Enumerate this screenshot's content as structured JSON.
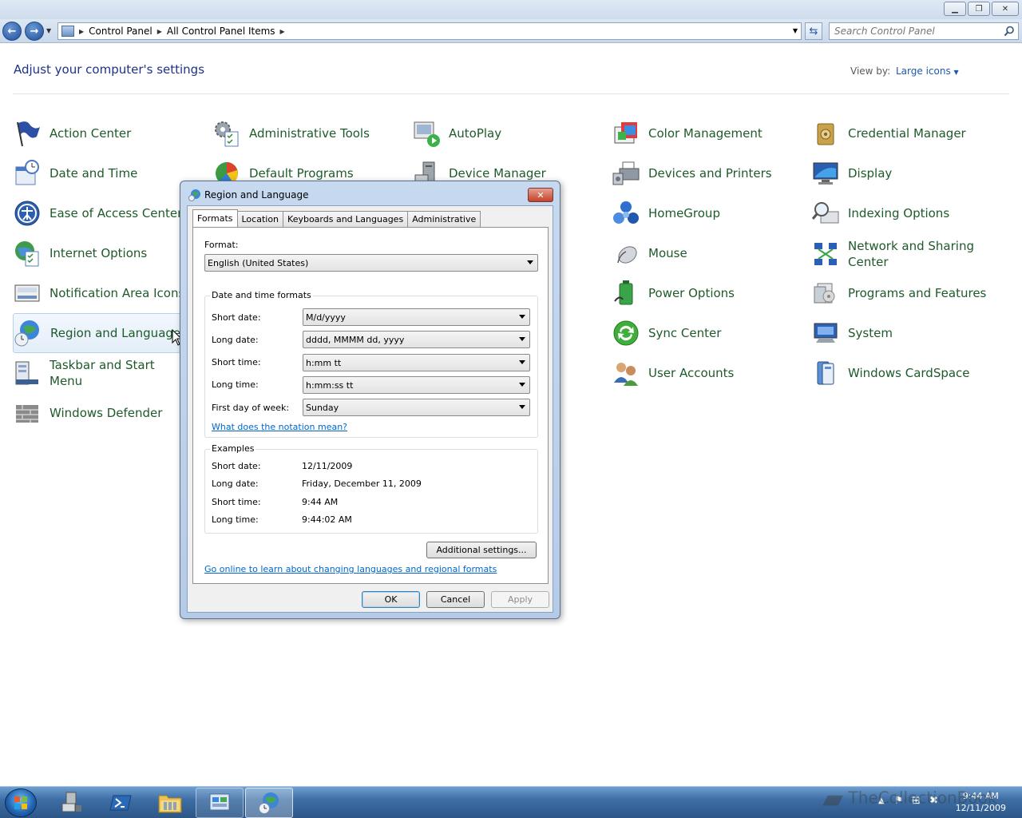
{
  "window": {
    "buttons": [
      "minimize",
      "restore",
      "close"
    ]
  },
  "navbar": {
    "breadcrumbs": [
      "Control Panel",
      "All Control Panel Items"
    ],
    "search_placeholder": "Search Control Panel"
  },
  "content": {
    "heading": "Adjust your computer's settings",
    "view_by_label": "View by:",
    "view_by_value": "Large icons"
  },
  "items": [
    {
      "label": "Action Center",
      "icon": "flag-icon"
    },
    {
      "label": "Administrative Tools",
      "icon": "admin-tools-icon"
    },
    {
      "label": "AutoPlay",
      "icon": "autoplay-icon"
    },
    {
      "label": "Color Management",
      "icon": "color-management-icon"
    },
    {
      "label": "Credential Manager",
      "icon": "credential-manager-icon"
    },
    {
      "label": "Date and Time",
      "icon": "calendar-clock-icon"
    },
    {
      "label": "Default Programs",
      "icon": "default-programs-icon"
    },
    {
      "label": "Device Manager",
      "icon": "device-manager-icon"
    },
    {
      "label": "Devices and Printers",
      "icon": "printer-icon"
    },
    {
      "label": "Display",
      "icon": "display-icon"
    },
    {
      "label": "Ease of Access Center",
      "icon": "ease-of-access-icon"
    },
    {
      "label": "HomeGroup",
      "icon": "homegroup-icon"
    },
    {
      "label": "Indexing Options",
      "icon": "indexing-icon"
    },
    {
      "label": "Internet Options",
      "icon": "internet-options-icon"
    },
    {
      "label": "Mouse",
      "icon": "mouse-icon"
    },
    {
      "label": "Network and Sharing Center",
      "icon": "network-icon"
    },
    {
      "label": "Notification Area Icons",
      "icon": "notification-area-icon"
    },
    {
      "label": "Power Options",
      "icon": "power-options-icon"
    },
    {
      "label": "Programs and Features",
      "icon": "programs-features-icon"
    },
    {
      "label": "Region and Language",
      "icon": "globe-clock-icon"
    },
    {
      "label": "Sync Center",
      "icon": "sync-icon"
    },
    {
      "label": "System",
      "icon": "system-icon"
    },
    {
      "label": "Taskbar and Start Menu",
      "icon": "taskbar-icon"
    },
    {
      "label": "User Accounts",
      "icon": "users-icon"
    },
    {
      "label": "Windows CardSpace",
      "icon": "cardspace-icon"
    },
    {
      "label": "Windows Defender",
      "icon": "defender-icon"
    }
  ],
  "dialog": {
    "title": "Region and Language",
    "close_label": "✕",
    "tabs": [
      "Formats",
      "Location",
      "Keyboards and Languages",
      "Administrative"
    ],
    "format_label": "Format:",
    "format_value": "English (United States)",
    "dt_group_title": "Date and time formats",
    "fields": [
      {
        "label": "Short date:",
        "value": "M/d/yyyy"
      },
      {
        "label": "Long date:",
        "value": "dddd, MMMM dd, yyyy"
      },
      {
        "label": "Short time:",
        "value": "h:mm tt"
      },
      {
        "label": "Long time:",
        "value": "h:mm:ss tt"
      },
      {
        "label": "First day of week:",
        "value": "Sunday"
      }
    ],
    "notation_link": "What does the notation mean?",
    "examples_title": "Examples",
    "examples": [
      {
        "label": "Short date:",
        "value": "12/11/2009"
      },
      {
        "label": "Long date:",
        "value": "Friday, December 11, 2009"
      },
      {
        "label": "Short time:",
        "value": "9:44 AM"
      },
      {
        "label": "Long time:",
        "value": "9:44:02 AM"
      }
    ],
    "additional_settings": "Additional settings...",
    "online_link": "Go online to learn about changing languages and regional formats",
    "ok": "OK",
    "cancel": "Cancel",
    "apply": "Apply"
  },
  "taskbar": {
    "items": [
      "server-manager-icon",
      "powershell-icon",
      "explorer-icon",
      "control-panel-icon",
      "region-language-icon"
    ],
    "clock_time": "9:44 AM",
    "clock_date": "12/11/2009"
  },
  "watermark": "TheCollectionBook",
  "colors": {
    "link": "#0066cc",
    "heading": "#1e3287",
    "item_label": "#1e5a2a",
    "taskbar": "#3e6ea5"
  }
}
